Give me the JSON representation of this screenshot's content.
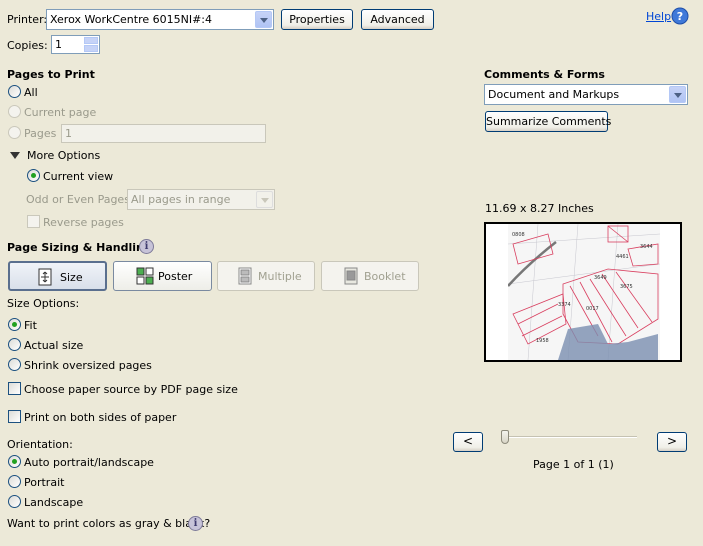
{
  "printer": {
    "label": "Printer:",
    "value": "Xerox WorkCentre 6015NI#:4",
    "properties_label": "Properties",
    "advanced_label": "Advanced"
  },
  "help": {
    "label": "Help",
    "icon": "help-icon"
  },
  "copies": {
    "label": "Copies:",
    "value": "1"
  },
  "pages_to_print": {
    "heading": "Pages to Print",
    "all_label": "All",
    "current_page_label": "Current page",
    "pages_label": "Pages",
    "pages_value": "1",
    "more_options_label": "More Options",
    "current_view_label": "Current view",
    "odd_even_label": "Odd or Even Pages:",
    "odd_even_value": "All pages in range",
    "reverse_label": "Reverse pages"
  },
  "sizing": {
    "heading": "Page Sizing & Handling",
    "buttons": {
      "size": "Size",
      "poster": "Poster",
      "multiple": "Multiple",
      "booklet": "Booklet"
    },
    "size_options_label": "Size Options:",
    "fit_label": "Fit",
    "actual_label": "Actual size",
    "shrink_label": "Shrink oversized pages",
    "paper_source_label": "Choose paper source by PDF page size",
    "both_sides_label": "Print on both sides of paper"
  },
  "orientation": {
    "label": "Orientation:",
    "auto_label": "Auto portrait/landscape",
    "portrait_label": "Portrait",
    "landscape_label": "Landscape"
  },
  "gray_prompt": "Want to print colors as gray & black?",
  "comments": {
    "heading": "Comments & Forms",
    "value": "Document and Markups",
    "summarize_label": "Summarize Comments"
  },
  "preview": {
    "dimensions": "11.69 x 8.27 Inches",
    "page_status": "Page 1 of 1 (1)",
    "prev_label": "<",
    "next_label": ">",
    "map_labels": [
      "0808",
      "3644",
      "4461",
      "3649",
      "3675",
      "3374",
      "1958",
      "0017"
    ]
  },
  "colors": {
    "accent": "#0046d5",
    "select_border": "#7f9db9",
    "radio_dot": "#21a121",
    "map_parcel": "#d94060"
  }
}
